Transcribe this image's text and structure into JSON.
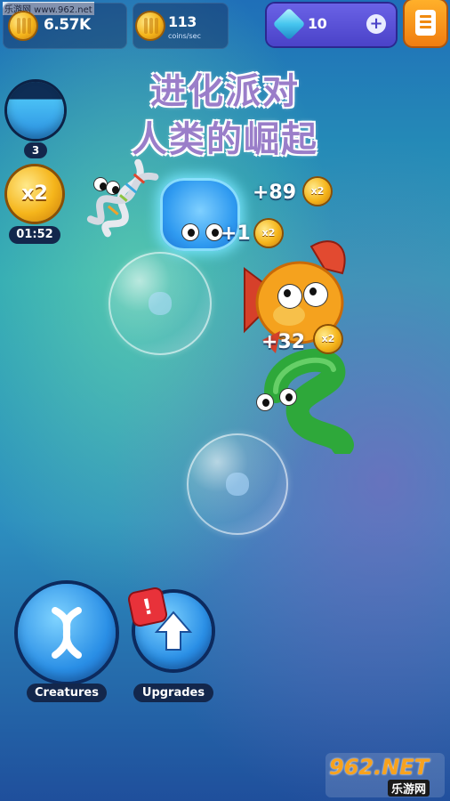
{
  "watermark": {
    "top_left": "乐游网 www.962.net",
    "logo_top": "962.NET",
    "logo_bottom": "乐游网"
  },
  "hud": {
    "coins": "6.57K",
    "rate_value": "113",
    "rate_unit": "coins/sec",
    "gems": "10",
    "gems_plus": "+"
  },
  "title": {
    "line1": "进化派对",
    "line2": "人类的崛起"
  },
  "left_panel": {
    "level": "3",
    "boost_label": "x2",
    "boost_timer": "01:52"
  },
  "floating": [
    {
      "text": "+89"
    },
    {
      "text": "+1"
    },
    {
      "text": "+32"
    }
  ],
  "coin_badges": [
    "x2",
    "x2",
    "x2"
  ],
  "buttons": {
    "creatures": "Creatures",
    "upgrades": "Upgrades",
    "alert": "!"
  },
  "colors": {
    "accent_gem": "#5a52d8",
    "accent_menu": "#f5901a",
    "alert": "#e8323a"
  }
}
